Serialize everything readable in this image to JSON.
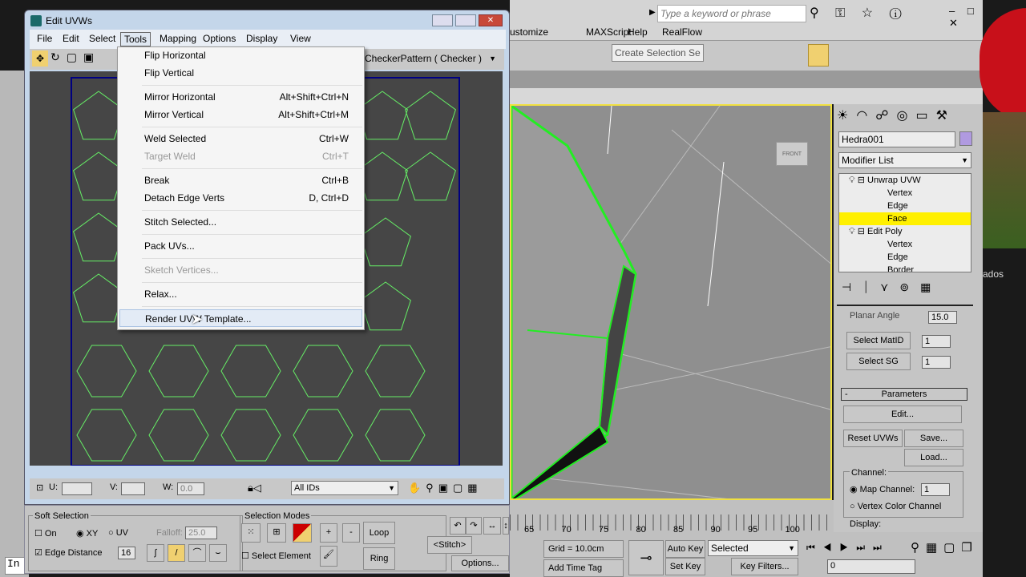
{
  "main_window": {
    "search_placeholder": "Type a keyword or phrase",
    "menu": [
      "ustomize",
      "MAXScript",
      "Help",
      "RealFlow"
    ],
    "selection_set": "Create Selection Se",
    "background_text": "ados"
  },
  "command_panel": {
    "object_name": "Hedra001",
    "object_color": "#b09ae0",
    "modifier_list": "Modifier List",
    "stack": [
      {
        "label": "Unwrap UVW",
        "level": 0
      },
      {
        "label": "Vertex",
        "level": 1
      },
      {
        "label": "Edge",
        "level": 1
      },
      {
        "label": "Face",
        "level": 1,
        "selected": true
      },
      {
        "label": "Edit Poly",
        "level": 0
      },
      {
        "label": "Vertex",
        "level": 1
      },
      {
        "label": "Edge",
        "level": 1
      },
      {
        "label": "Border",
        "level": 1
      }
    ],
    "planar_angle_label": "Planar Angle",
    "planar_angle": "15.0",
    "select_matid": "Select MatID",
    "matid_value": "1",
    "select_sg": "Select SG",
    "sg_value": "1",
    "parameters_title": "Parameters",
    "parameters_collapse": "-",
    "edit": "Edit...",
    "reset_uvws": "Reset UVWs",
    "save": "Save...",
    "load": "Load...",
    "channel_label": "Channel:",
    "map_channel": "Map Channel:",
    "map_channel_value": "1",
    "vertex_color_channel": "Vertex Color Channel",
    "display_label": "Display:"
  },
  "viewport": {
    "viewcube_label": "FRONT"
  },
  "timeline": {
    "ticks": [
      "65",
      "70",
      "75",
      "80",
      "85",
      "90",
      "95",
      "100"
    ],
    "grid": "Grid = 10.0cm",
    "add_time_tag": "Add Time Tag",
    "auto_key": "Auto Key",
    "set_key": "Set Key",
    "key_mode": "Selected",
    "key_filters": "Key Filters...",
    "frame": "0"
  },
  "uv_editor": {
    "title": "Edit UVWs",
    "menu": [
      "File",
      "Edit",
      "Select",
      "Tools",
      "Mapping",
      "Options",
      "Display",
      "View"
    ],
    "active_menu": "Tools",
    "texture_dropdown": "CheckerPattern  ( Checker )",
    "tools_menu": [
      {
        "label": "Flip Horizontal",
        "shortcut": ""
      },
      {
        "label": "Flip Vertical",
        "shortcut": ""
      },
      {
        "label": "Mirror Horizontal",
        "shortcut": "Alt+Shift+Ctrl+N"
      },
      {
        "label": "Mirror Vertical",
        "shortcut": "Alt+Shift+Ctrl+M"
      },
      {
        "label": "Weld Selected",
        "shortcut": "Ctrl+W"
      },
      {
        "label": "Target Weld",
        "shortcut": "Ctrl+T",
        "disabled": true
      },
      {
        "label": "Break",
        "shortcut": "Ctrl+B"
      },
      {
        "label": "Detach Edge Verts",
        "shortcut": "D, Ctrl+D"
      },
      {
        "label": "Stitch Selected...",
        "shortcut": ""
      },
      {
        "label": "Pack UVs...",
        "shortcut": ""
      },
      {
        "label": "Sketch Vertices...",
        "shortcut": "",
        "disabled": true
      },
      {
        "label": "Relax...",
        "shortcut": ""
      },
      {
        "label": "Render UVW Template...",
        "shortcut": "",
        "highlighted": true
      }
    ],
    "u_label": "U:",
    "v_label": "V:",
    "w_label": "W:",
    "w_value": "0.0",
    "ids_dropdown": "All IDs",
    "soft_selection": {
      "title": "Soft Selection",
      "on": "On",
      "on_checked": false,
      "xy": "XY",
      "uv": "UV",
      "mode": "XY",
      "falloff_label": "Falloff:",
      "falloff": "25.0",
      "edge_distance": "Edge Distance",
      "edge_distance_checked": true,
      "edge_distance_value": "16"
    },
    "selection_modes": {
      "title": "Selection Modes",
      "plus": "+",
      "minus": "-",
      "loop": "Loop",
      "ring": "Ring",
      "select_element": "Select Element",
      "select_element_checked": false
    },
    "stitch": "Stitch",
    "options": "Options...",
    "wire_color": "#66ee66",
    "border_color": "#000080"
  },
  "left_status": "In"
}
